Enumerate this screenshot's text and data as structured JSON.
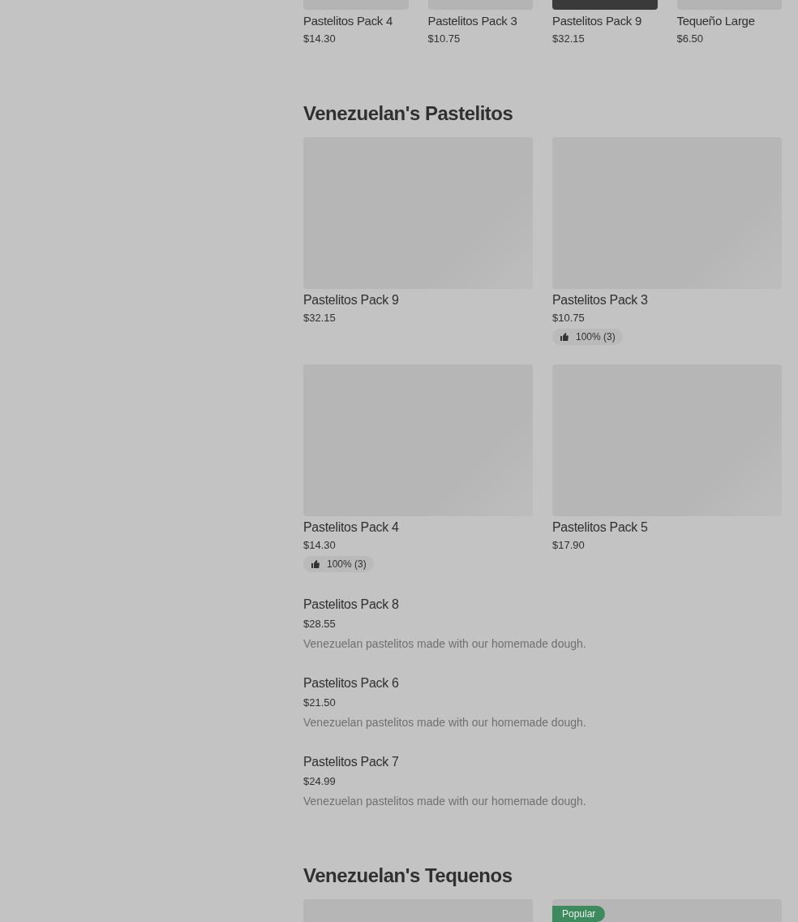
{
  "top_strip": [
    {
      "name": "Pastelitos Pack 4",
      "price": "$14.30",
      "kind": "placeholder"
    },
    {
      "name": "Pastelitos Pack 3",
      "price": "$10.75",
      "kind": "placeholder"
    },
    {
      "name": "Pastelitos Pack 9",
      "price": "$32.15"
    },
    {
      "name": "Tequeño Large",
      "price": "$6.50",
      "kind": "placeholder"
    }
  ],
  "sections": [
    {
      "title": "Venezuelan's Pastelitos",
      "cards": [
        {
          "kind": "card",
          "name": "Pastelitos Pack 9",
          "price": "$32.15"
        },
        {
          "kind": "card",
          "name": "Pastelitos Pack 3",
          "price": "$10.75",
          "rating": "100% (3)"
        },
        {
          "kind": "card",
          "name": "Pastelitos Pack 4",
          "price": "$14.30",
          "rating": "100% (3)"
        },
        {
          "kind": "card",
          "name": "Pastelitos Pack 5",
          "price": "$17.90"
        }
      ],
      "list": [
        {
          "name": "Pastelitos Pack 8",
          "price": "$28.55",
          "description": "Venezuelan pastelitos made with our homemade dough."
        },
        {
          "name": "Pastelitos Pack 6",
          "price": "$21.50",
          "description": "Venezuelan pastelitos made with our homemade dough."
        },
        {
          "name": "Pastelitos Pack 7",
          "price": "$24.99",
          "description": "Venezuelan pastelitos made with our homemade dough."
        }
      ]
    },
    {
      "title": "Venezuelan's Tequenos",
      "cards": [
        {
          "kind": "card"
        },
        {
          "kind": "card",
          "badge": "Popular"
        }
      ]
    }
  ]
}
